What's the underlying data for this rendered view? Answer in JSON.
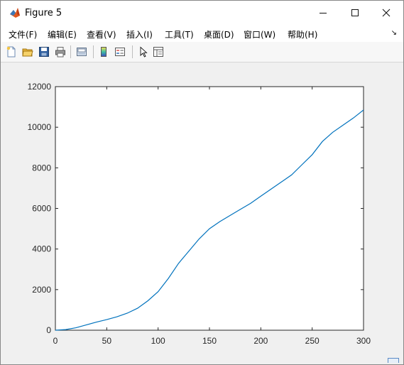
{
  "window": {
    "title": "Figure 5",
    "controls": {
      "minimize": "minimize",
      "maximize": "maximize",
      "close": "close"
    }
  },
  "menu": {
    "items": [
      {
        "label": "文件(F)"
      },
      {
        "label": "编辑(E)"
      },
      {
        "label": "查看(V)"
      },
      {
        "label": "插入(I)"
      },
      {
        "label": "工具(T)"
      },
      {
        "label": "桌面(D)"
      },
      {
        "label": "窗口(W)"
      },
      {
        "label": "帮助(H)"
      }
    ]
  },
  "toolbar": {
    "buttons": [
      {
        "icon": "new-figure-icon"
      },
      {
        "icon": "open-file-icon"
      },
      {
        "icon": "save-icon"
      },
      {
        "icon": "print-icon"
      },
      {
        "icon": "link-plot-icon"
      },
      {
        "icon": "colorbar-icon"
      },
      {
        "icon": "legend-icon"
      },
      {
        "icon": "edit-plot-arrow-icon"
      },
      {
        "icon": "property-inspector-icon"
      }
    ]
  },
  "chart_data": {
    "type": "line",
    "title": "",
    "xlabel": "",
    "ylabel": "",
    "xlim": [
      0,
      300
    ],
    "ylim": [
      0,
      12000
    ],
    "xticks": [
      0,
      50,
      100,
      150,
      200,
      250,
      300
    ],
    "yticks": [
      0,
      2000,
      4000,
      6000,
      8000,
      10000,
      12000
    ],
    "grid": false,
    "line_color": "#0072bd",
    "series": [
      {
        "x": [
          0,
          10,
          20,
          30,
          40,
          50,
          60,
          70,
          80,
          90,
          100,
          110,
          120,
          130,
          140,
          150,
          160,
          170,
          180,
          190,
          200,
          210,
          220,
          230,
          240,
          250,
          260,
          270,
          280,
          290,
          300
        ],
        "values": [
          0,
          30,
          120,
          260,
          400,
          520,
          660,
          840,
          1080,
          1450,
          1900,
          2550,
          3300,
          3900,
          4500,
          5000,
          5350,
          5650,
          5950,
          6250,
          6600,
          6950,
          7300,
          7650,
          8150,
          8650,
          9300,
          9750,
          10100,
          10450,
          10850
        ]
      }
    ]
  }
}
